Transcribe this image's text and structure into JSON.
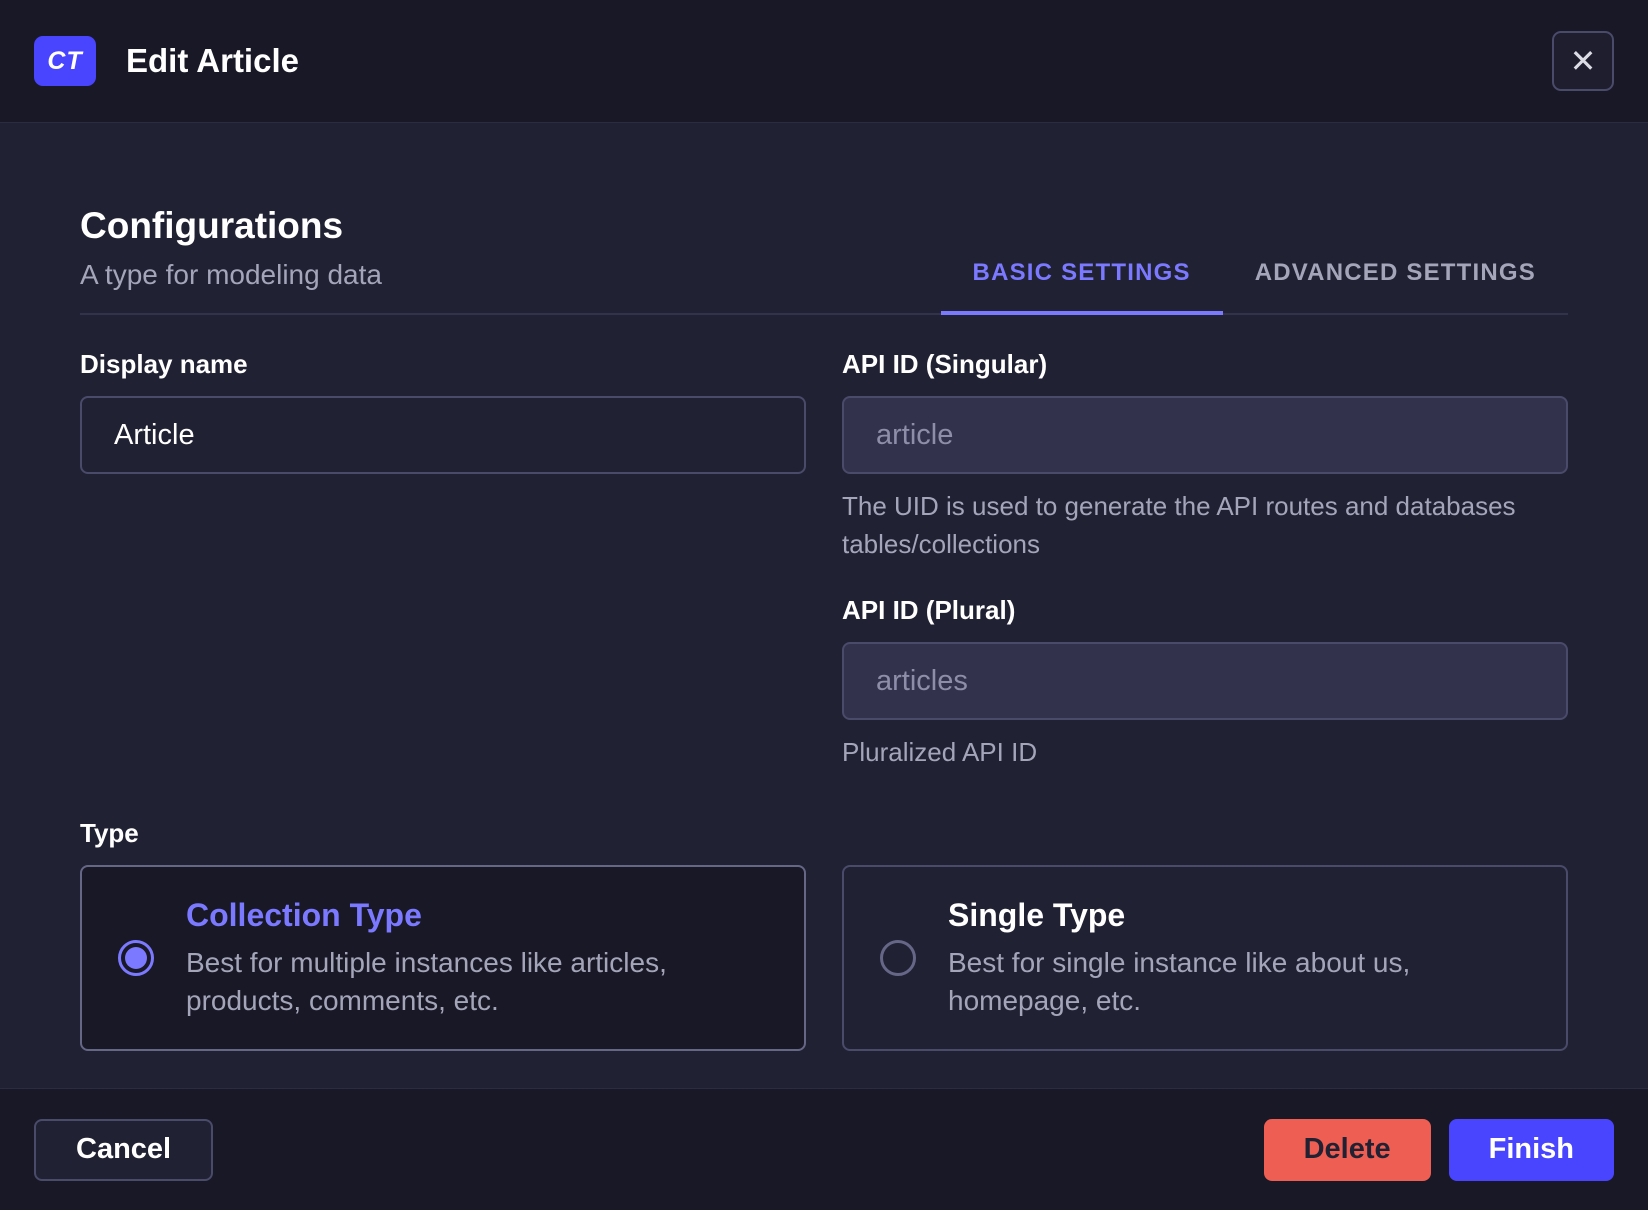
{
  "colors": {
    "primary": "#4945ff",
    "primary_light": "#7b79ff",
    "danger": "#ee5e52",
    "bg_dark": "#181826",
    "bg_body": "#212134"
  },
  "header": {
    "badge": "CT",
    "title": "Edit Article",
    "close_icon": "✕"
  },
  "config": {
    "title": "Configurations",
    "subtitle": "A type for modeling data",
    "tabs": [
      {
        "label": "BASIC SETTINGS",
        "active": true
      },
      {
        "label": "ADVANCED SETTINGS",
        "active": false
      }
    ]
  },
  "form": {
    "display_name": {
      "label": "Display name",
      "value": "Article"
    },
    "api_id_singular": {
      "label": "API ID (Singular)",
      "value": "article",
      "hint": "The UID is used to generate the API routes and databases tables/collections"
    },
    "api_id_plural": {
      "label": "API ID (Plural)",
      "value": "articles",
      "hint": "Pluralized API ID"
    },
    "type": {
      "label": "Type",
      "options": [
        {
          "title": "Collection Type",
          "description": "Best for multiple instances like articles, products, comments, etc.",
          "selected": true
        },
        {
          "title": "Single Type",
          "description": "Best for single instance like about us, homepage, etc.",
          "selected": false
        }
      ]
    }
  },
  "footer": {
    "cancel_label": "Cancel",
    "delete_label": "Delete",
    "finish_label": "Finish"
  }
}
